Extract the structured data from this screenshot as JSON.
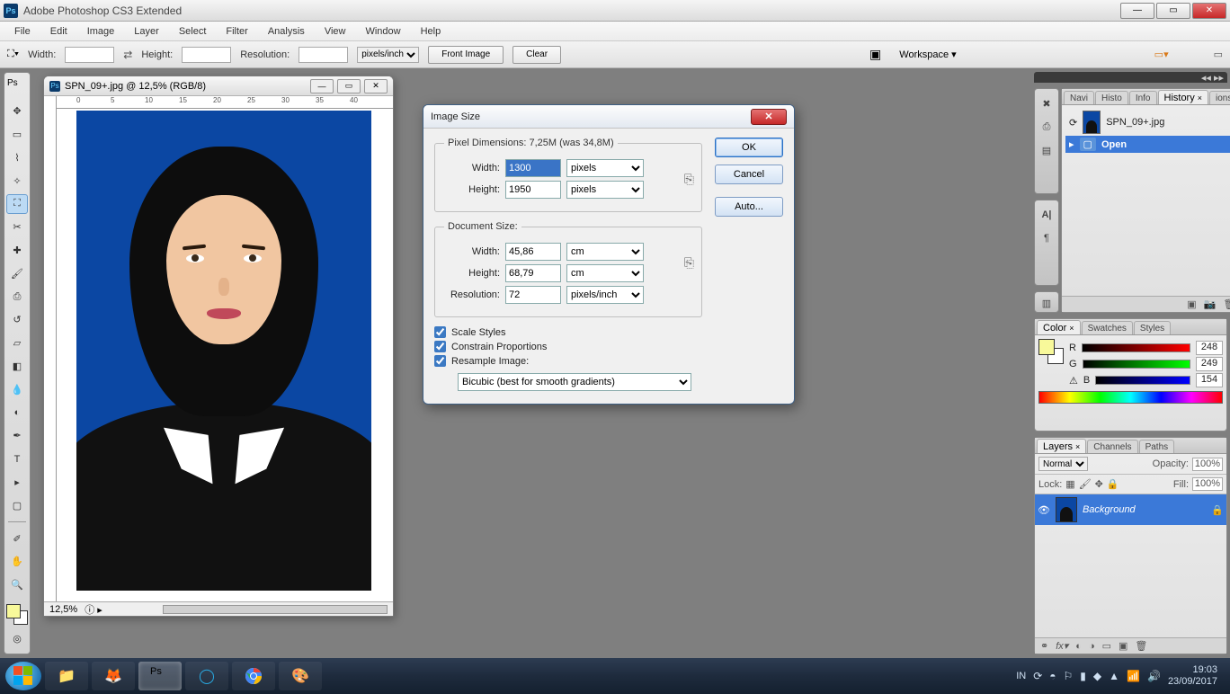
{
  "app": {
    "title": "Adobe Photoshop CS3 Extended"
  },
  "menu": {
    "items": [
      "File",
      "Edit",
      "Image",
      "Layer",
      "Select",
      "Filter",
      "Analysis",
      "View",
      "Window",
      "Help"
    ]
  },
  "options": {
    "width_label": "Width:",
    "height_label": "Height:",
    "resolution_label": "Resolution:",
    "px_unit": "pixels/inch",
    "front_image": "Front Image",
    "clear": "Clear",
    "workspace": "Workspace ▾"
  },
  "document": {
    "title": "SPN_09+.jpg @ 12,5% (RGB/8)",
    "zoom": "12,5%",
    "ruler_marks": [
      "0",
      "5",
      "10",
      "15",
      "20",
      "25",
      "30",
      "35",
      "40"
    ]
  },
  "dialog": {
    "title": "Image Size",
    "ok": "OK",
    "cancel": "Cancel",
    "auto": "Auto...",
    "pixel_dims_legend": "Pixel Dimensions:  7,25M (was 34,8M)",
    "width_label": "Width:",
    "height_label": "Height:",
    "px_unit": "pixels",
    "width_val": "1300",
    "height_val": "1950",
    "doc_size_legend": "Document Size:",
    "doc_width": "45,86",
    "doc_height": "68,79",
    "doc_unit": "cm",
    "res_label": "Resolution:",
    "res_val": "72",
    "res_unit": "pixels/inch",
    "scale_styles": "Scale Styles",
    "constrain": "Constrain Proportions",
    "resample": "Resample Image:",
    "resample_mode": "Bicubic (best for smooth gradients)"
  },
  "history": {
    "tabs": [
      "Navi",
      "Histo",
      "Info"
    ],
    "tab_active": "History",
    "tabs_after": [
      "ions"
    ],
    "source": "SPN_09+.jpg",
    "step": "Open"
  },
  "color": {
    "tab_active": "Color",
    "tabs": [
      "Swatches",
      "Styles"
    ],
    "r": "248",
    "g": "249",
    "b": "154",
    "r_sym": "R",
    "g_sym": "G",
    "b_sym": "B"
  },
  "layers": {
    "tab_active": "Layers",
    "tabs": [
      "Channels",
      "Paths"
    ],
    "mode": "Normal",
    "opacity_label": "Opacity:",
    "opacity": "100%",
    "lock_label": "Lock:",
    "fill_label": "Fill:",
    "fill": "100%",
    "layer_name": "Background"
  },
  "taskbar": {
    "lang": "IN",
    "time": "19:03",
    "date": "23/09/2017"
  }
}
